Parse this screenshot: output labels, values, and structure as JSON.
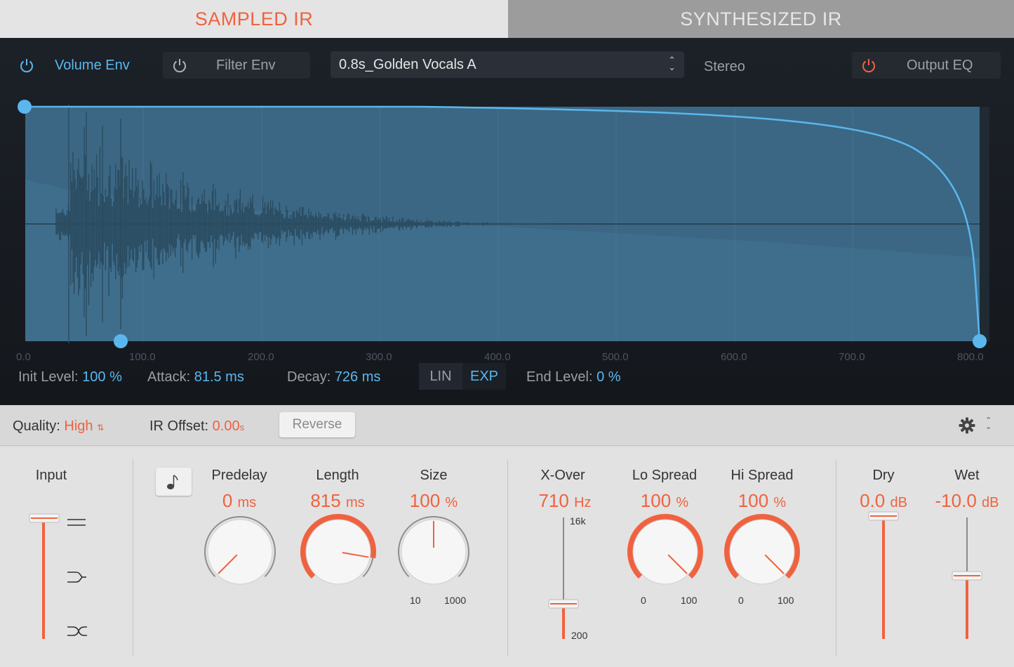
{
  "tabs": {
    "sampled": "SAMPLED IR",
    "synthesized": "SYNTHESIZED IR"
  },
  "envelope_toolbar": {
    "volume_env": "Volume Env",
    "filter_env": "Filter Env",
    "ir_file": "0.8s_Golden Vocals A",
    "stereo": "Stereo",
    "output_eq": "Output EQ"
  },
  "time_axis": [
    "0.0",
    "100.0",
    "200.0",
    "300.0",
    "400.0",
    "500.0",
    "600.0",
    "700.0",
    "800.0"
  ],
  "envelope_params": {
    "init_level_label": "Init Level:",
    "init_level_value": "100 %",
    "attack_label": "Attack:",
    "attack_value": "81.5 ms",
    "decay_label": "Decay:",
    "decay_value": "726 ms",
    "lin": "LIN",
    "exp": "EXP",
    "end_level_label": "End Level:",
    "end_level_value": "0 %"
  },
  "midbar": {
    "quality_label": "Quality:",
    "quality_value": "High",
    "ir_offset_label": "IR Offset:",
    "ir_offset_value": "0.00",
    "ir_offset_unit": "s",
    "reverse": "Reverse"
  },
  "input": {
    "label": "Input"
  },
  "predelay": {
    "label": "Predelay",
    "value": "0",
    "unit": "ms",
    "fraction": 0.0
  },
  "length": {
    "label": "Length",
    "value": "815",
    "unit": "ms",
    "fraction": 0.87
  },
  "size": {
    "label": "Size",
    "value": "100",
    "unit": "%",
    "min": "10",
    "max": "1000",
    "fraction": 0.5
  },
  "xover": {
    "label": "X-Over",
    "value": "710",
    "unit": "Hz",
    "top": "16k",
    "bottom": "200",
    "fraction": 0.27
  },
  "lo_spread": {
    "label": "Lo Spread",
    "value": "100",
    "unit": "%",
    "min": "0",
    "max": "100",
    "fraction": 1.0
  },
  "hi_spread": {
    "label": "Hi Spread",
    "value": "100",
    "unit": "%",
    "min": "0",
    "max": "100",
    "fraction": 1.0
  },
  "dry": {
    "label": "Dry",
    "value": "0.0",
    "unit": "dB",
    "fraction": 1.0
  },
  "wet": {
    "label": "Wet",
    "value": "-10.0",
    "unit": "dB",
    "fraction": 0.51
  },
  "colors": {
    "accent": "#f0623f",
    "blue": "#5ab7ee",
    "wave": "#3d6a86"
  }
}
